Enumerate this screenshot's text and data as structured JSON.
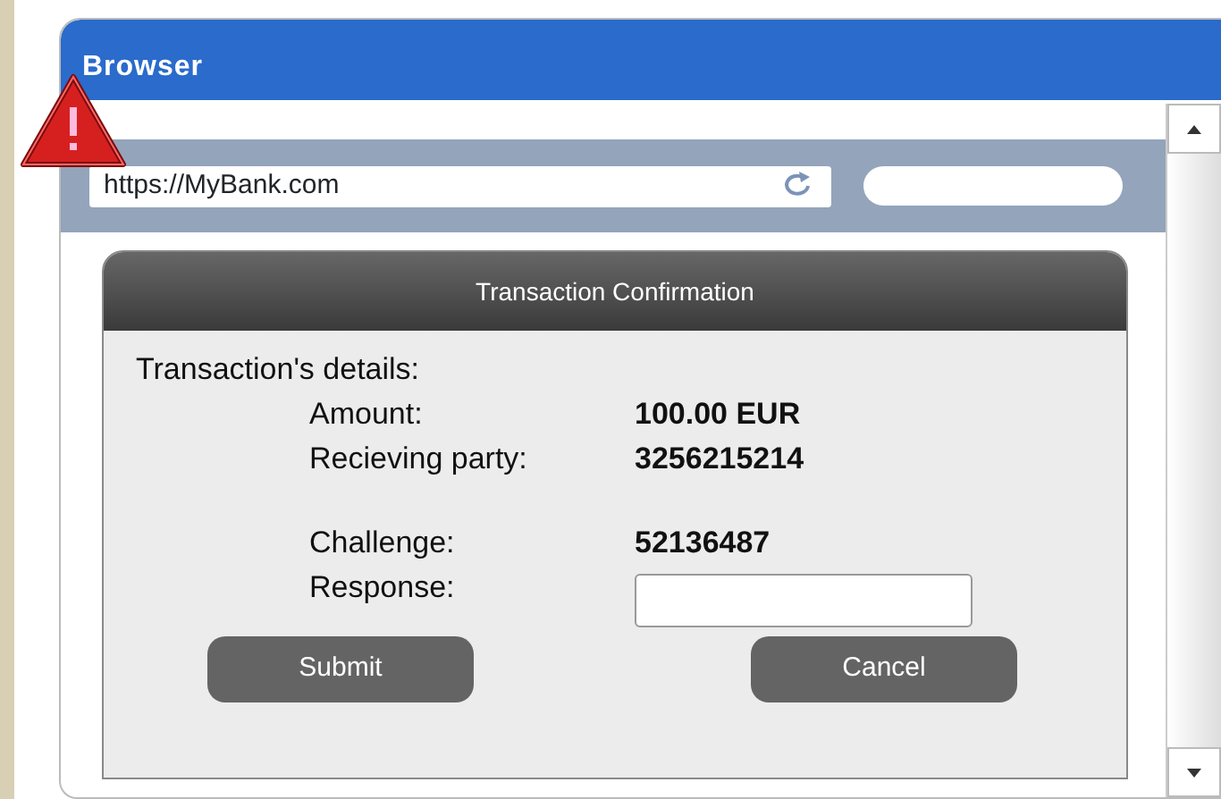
{
  "window": {
    "title": "Browser"
  },
  "address_bar": {
    "value": "https://MyBank.com"
  },
  "dialog": {
    "title": "Transaction Confirmation",
    "heading": "Transaction's details:",
    "details": [
      {
        "label": "Amount:",
        "value": "100.00 EUR"
      },
      {
        "label": "Recieving party:",
        "value": "3256215214"
      }
    ],
    "challenge": {
      "label": "Challenge:",
      "value": "52136487"
    },
    "response": {
      "label": "Response:"
    },
    "buttons": [
      "Submit",
      "Cancel"
    ]
  }
}
